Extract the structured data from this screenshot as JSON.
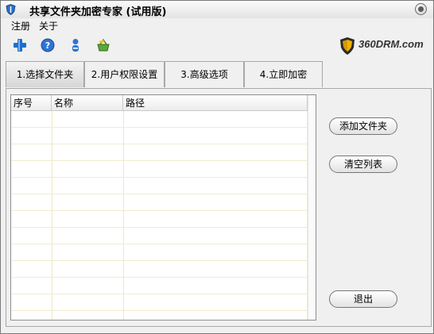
{
  "window": {
    "title": "共享文件夹加密专家 (试用版)"
  },
  "menu": {
    "register": "注册",
    "about": "关于"
  },
  "toolbar": {
    "icons": [
      "plus-icon",
      "help-icon",
      "user-icon",
      "basket-icon"
    ]
  },
  "logo": {
    "text": "360DRM.com"
  },
  "tabs": [
    {
      "label": "1.选择文件夹",
      "active": true
    },
    {
      "label": "2.用户权限设置",
      "active": false
    },
    {
      "label": "3.高级选项",
      "active": false
    },
    {
      "label": "4.立即加密",
      "active": false
    }
  ],
  "table": {
    "columns": [
      "序号",
      "名称",
      "路径"
    ],
    "rows": []
  },
  "buttons": {
    "add_folder": "添加文件夹",
    "clear_list": "清空列表",
    "exit": "退出"
  },
  "colors": {
    "accent_blue": "#1e6fd0",
    "logo_yellow": "#f0b400"
  }
}
